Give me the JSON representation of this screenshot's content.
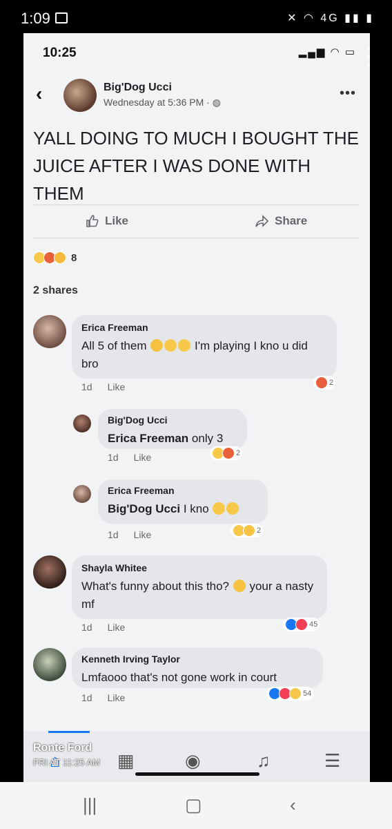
{
  "outer_status": {
    "time": "1:09",
    "signal_text": "4G"
  },
  "inner_status": {
    "time": "10:25"
  },
  "post": {
    "author": "Big'Dog Ucci",
    "meta": "Wednesday at 5:36 PM ·",
    "text": "YALL DOING TO MUCH I BOUGHT THE JUICE AFTER I WAS DONE WITH THEM",
    "like_label": "Like",
    "share_label": "Share",
    "reaction_count": "8",
    "shares_label": "2 shares"
  },
  "comments": [
    {
      "name": "Erica Freeman",
      "text_a": "All 5 of them",
      "text_b": "I'm playing I kno u did bro",
      "time": "1d",
      "like": "Like",
      "reactions": "2"
    },
    {
      "name": "Big'Dog Ucci",
      "mention": "Erica Freeman",
      "text": "only 3",
      "time": "1d",
      "like": "Like",
      "reactions": "2"
    },
    {
      "name": "Erica Freeman",
      "mention": "Big'Dog Ucci",
      "text": "I kno",
      "time": "1d",
      "like": "Like",
      "reactions": "2"
    },
    {
      "name": "Shayla Whitee",
      "text_a": "What's funny about this tho?",
      "text_b": "your a nasty mf",
      "time": "1d",
      "like": "Like",
      "reactions": "45"
    },
    {
      "name": "Kenneth Irving Taylor",
      "text": "Lmfaooo that's not gone work in court",
      "time": "1d",
      "like": "Like",
      "reactions": "54"
    }
  ],
  "overlay": {
    "name": "Ronte Ford",
    "time": "FRI AT 11:25 AM"
  },
  "colors": {
    "accent": "#1877f2",
    "bubble": "#e4e6ea",
    "background": "#f2f3f5"
  }
}
